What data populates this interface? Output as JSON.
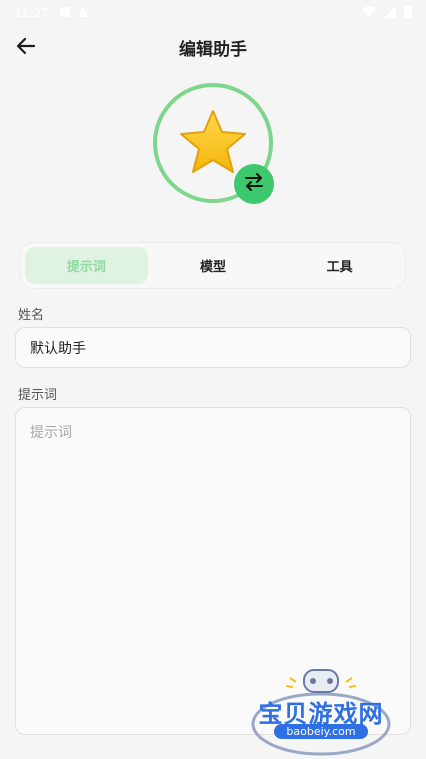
{
  "status_bar": {
    "time": "11:27"
  },
  "header": {
    "title": "编辑助手"
  },
  "tabs": [
    {
      "label": "提示词",
      "active": true
    },
    {
      "label": "模型",
      "active": false
    },
    {
      "label": "工具",
      "active": false
    }
  ],
  "form": {
    "name_label": "姓名",
    "name_value": "默认助手",
    "prompt_label": "提示词",
    "prompt_placeholder": "提示词"
  },
  "watermark": {
    "text": "宝贝游戏网",
    "url": "baobeiy.com"
  },
  "colors": {
    "accent": "#3ec86e",
    "ring": "#7dd68b",
    "active_tab_bg": "#dff3e3"
  },
  "icons": [
    "back-arrow-icon",
    "star-avatar-icon",
    "swap-arrows-icon"
  ]
}
